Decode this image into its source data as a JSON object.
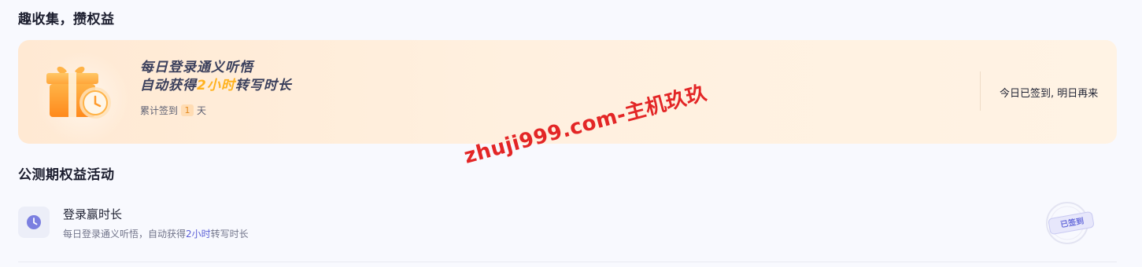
{
  "sections": {
    "rewards_title": "趣收集，攒权益",
    "activities_title": "公测期权益活动"
  },
  "checkin": {
    "headline_line1": "每日登录通义听悟",
    "headline_line2_prefix": "自动获得",
    "headline_line2_highlight": "2小时",
    "headline_line2_suffix": "转写时长",
    "streak_prefix": "累计签到",
    "streak_count": "1",
    "streak_suffix": "天",
    "status": "今日已签到, 明日再来",
    "icon": "gift-clock-icon"
  },
  "activity": {
    "title": "登录赢时长",
    "desc_prefix": "每日登录通义听悟，自动获得",
    "desc_highlight": "2小时",
    "desc_suffix": "转写时长",
    "stamp_label": "已签到",
    "icon": "clock-icon"
  },
  "watermark": {
    "text": "zhuji999.com-主机玖玖"
  },
  "colors": {
    "accent_orange": "#ffb21e",
    "accent_purple": "#7b7fe0",
    "watermark_red": "#e32626"
  }
}
